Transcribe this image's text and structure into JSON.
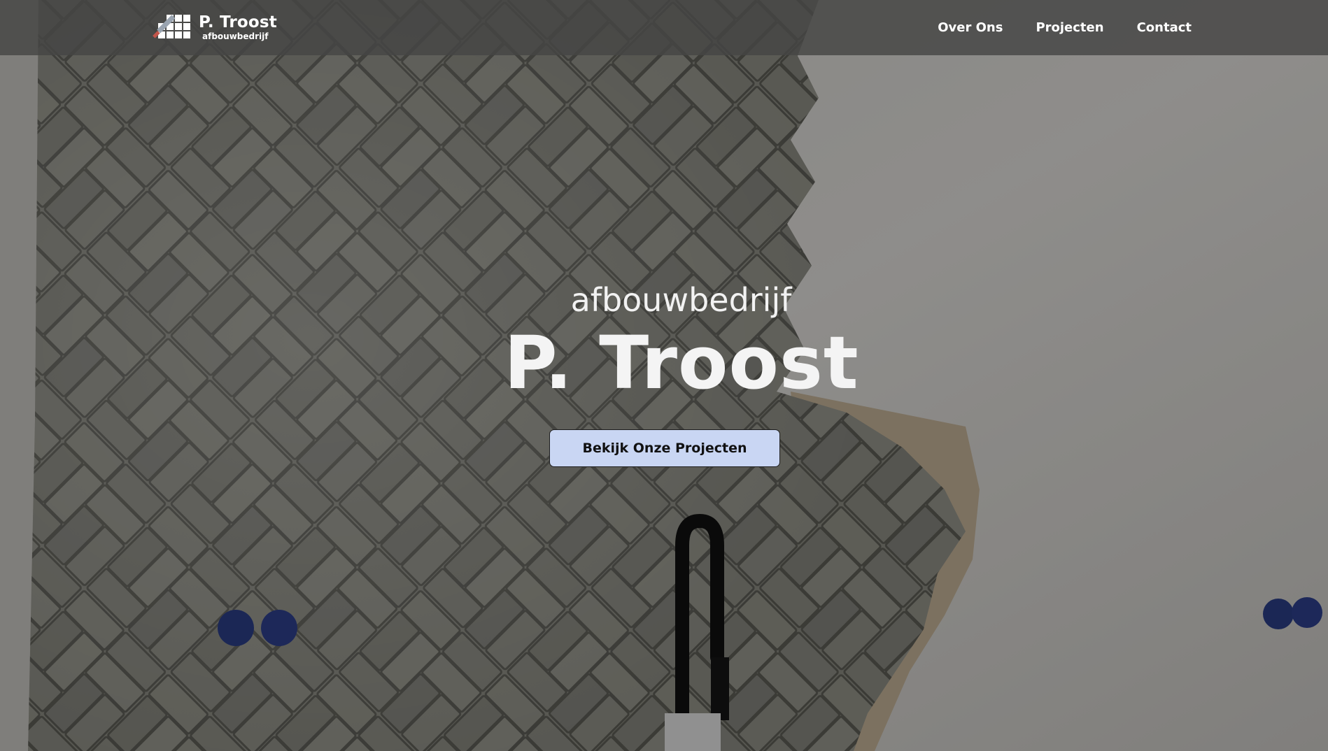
{
  "brand": {
    "name": "P. Troost",
    "tagline": "afbouwbedrijf",
    "logo_icon": "tile-trowel-icon"
  },
  "nav": {
    "items": [
      {
        "label": "Over Ons"
      },
      {
        "label": "Projecten"
      },
      {
        "label": "Contact"
      }
    ]
  },
  "hero": {
    "subtitle": "afbouwbedrijf",
    "title": "P. Troost",
    "cta_label": "Bekijk Onze Projecten",
    "background": "herringbone-tiled-wall-photo"
  },
  "colors": {
    "navbar": "#464644",
    "cta_background": "#c9d6f3",
    "text": "#ffffff"
  }
}
